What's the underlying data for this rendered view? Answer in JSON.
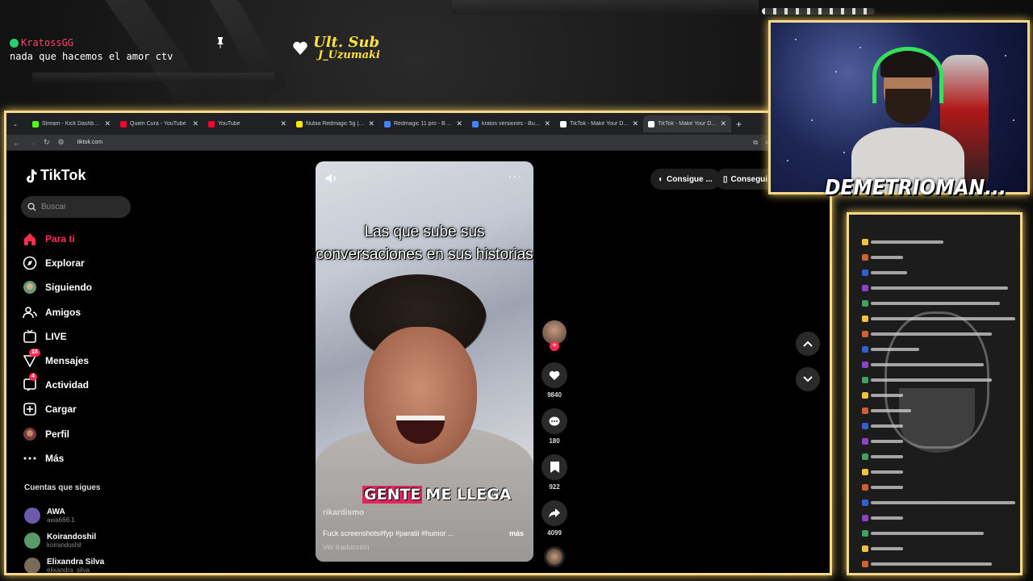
{
  "overlay": {
    "chat_user": "KratossGG",
    "chat_message": "nada que hacemos el amor ctv",
    "ult_sub_title": "Ult. Sub",
    "ult_sub_name": "J_Uzumaki",
    "streamer_name": "DEMETRIOMAN..."
  },
  "browser": {
    "tabs": [
      {
        "label": "Stream - Kick Dashboard",
        "color": "#53fc18"
      },
      {
        "label": "Quien Cura - YouTube",
        "color": "#ff0033"
      },
      {
        "label": "YouTube",
        "color": "#ff0033"
      },
      {
        "label": "Nubia Redmagic 5g | Mer",
        "color": "#ffe600"
      },
      {
        "label": "Redmagic 11 pro - Buscar",
        "color": "#4285f4"
      },
      {
        "label": "kratos versiones - Buscar",
        "color": "#4285f4"
      },
      {
        "label": "TikTok - Make Your Day",
        "color": "#ffffff"
      },
      {
        "label": "TikTok - Make Your Day",
        "color": "#ffffff"
      }
    ],
    "url": "tiktok.com"
  },
  "tiktok": {
    "brand": "TikTok",
    "search_placeholder": "Buscar",
    "menu": [
      {
        "label": "Para ti",
        "icon": "home-icon",
        "badge": ""
      },
      {
        "label": "Explorar",
        "icon": "compass-icon",
        "badge": ""
      },
      {
        "label": "Siguiendo",
        "icon": "following-avatar-icon",
        "badge": ""
      },
      {
        "label": "Amigos",
        "icon": "friends-icon",
        "badge": ""
      },
      {
        "label": "LIVE",
        "icon": "live-icon",
        "badge": ""
      },
      {
        "label": "Mensajes",
        "icon": "messages-icon",
        "badge": "18"
      },
      {
        "label": "Actividad",
        "icon": "activity-icon",
        "badge": "4"
      },
      {
        "label": "Cargar",
        "icon": "upload-icon",
        "badge": ""
      },
      {
        "label": "Perfil",
        "icon": "profile-avatar-icon",
        "badge": ""
      },
      {
        "label": "Más",
        "icon": "more-icon",
        "badge": ""
      }
    ],
    "following_header": "Cuentas que sigues",
    "following": [
      {
        "name": "AWA",
        "handle": "awa666.1"
      },
      {
        "name": "Koirandoshil",
        "handle": "koirandoshil"
      },
      {
        "name": "Elixandra Silva",
        "handle": "elixandra_silva"
      }
    ],
    "pills": [
      "Consigue ...",
      "Consegui"
    ],
    "video": {
      "caption": "Las que sube sus conversaciones en sus historias",
      "overlay_word1": "GENTE",
      "overlay_word2": "ME LLEGA",
      "author": "rikardismo",
      "description": "Fuck screenshots#fyp #paratii #humor ...",
      "more": "más",
      "translate": "Ver traducción"
    },
    "actions": {
      "likes": "9840",
      "comments": "180",
      "saves": "922",
      "shares": "4099"
    }
  }
}
